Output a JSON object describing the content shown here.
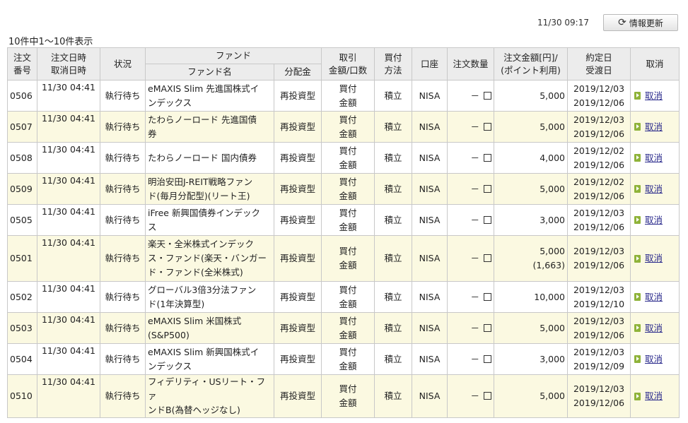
{
  "header": {
    "timestamp": "11/30 09:17",
    "refresh_label": "情報更新",
    "refresh_icon": "refresh-icon",
    "count_text": "10件中1～10件表示"
  },
  "table": {
    "headers": {
      "order_no": [
        "注文",
        "番号"
      ],
      "order_datetime": [
        "注文日時",
        "取消日時"
      ],
      "status": "状況",
      "fund_group": "ファンド",
      "fund_name": "ファンド名",
      "distribution": "分配金",
      "trade": [
        "取引",
        "金額/口数"
      ],
      "method": [
        "買付",
        "方法"
      ],
      "account": "口座",
      "quantity": "注文数量",
      "amount": [
        "注文金額[円]/",
        "(ポイント利用)"
      ],
      "dates": [
        "約定日",
        "受渡日"
      ],
      "cancel": "取消"
    },
    "rows": [
      {
        "no": "0506",
        "dt": "11/30 04:41",
        "status": "執行待ち",
        "fund": [
          "eMAXIS Slim 先進国株式イ",
          "ンデックス"
        ],
        "dist": "再投資型",
        "trade": [
          "買付",
          "金額"
        ],
        "method": "積立",
        "account": "NISA",
        "qty": "－",
        "amount": "5,000",
        "points": "",
        "date1": "2019/12/03",
        "date2": "2019/12/06",
        "cancel": "取消"
      },
      {
        "no": "0507",
        "dt": "11/30 04:41",
        "status": "執行待ち",
        "fund": [
          "たわらノーロード 先進国債",
          "券"
        ],
        "dist": "再投資型",
        "trade": [
          "買付",
          "金額"
        ],
        "method": "積立",
        "account": "NISA",
        "qty": "－",
        "amount": "5,000",
        "points": "",
        "date1": "2019/12/03",
        "date2": "2019/12/06",
        "cancel": "取消"
      },
      {
        "no": "0508",
        "dt": "11/30 04:41",
        "status": "執行待ち",
        "fund": [
          "たわらノーロード 国内債券",
          ""
        ],
        "dist": "再投資型",
        "trade": [
          "買付",
          "金額"
        ],
        "method": "積立",
        "account": "NISA",
        "qty": "－",
        "amount": "4,000",
        "points": "",
        "date1": "2019/12/02",
        "date2": "2019/12/06",
        "cancel": "取消"
      },
      {
        "no": "0509",
        "dt": "11/30 04:41",
        "status": "執行待ち",
        "fund": [
          "明治安田J-REIT戦略ファン",
          "ド(毎月分配型)(リート王)"
        ],
        "dist": "再投資型",
        "trade": [
          "買付",
          "金額"
        ],
        "method": "積立",
        "account": "NISA",
        "qty": "－",
        "amount": "5,000",
        "points": "",
        "date1": "2019/12/02",
        "date2": "2019/12/06",
        "cancel": "取消"
      },
      {
        "no": "0505",
        "dt": "11/30 04:41",
        "status": "執行待ち",
        "fund": [
          "iFree 新興国債券インデック",
          "ス"
        ],
        "dist": "再投資型",
        "trade": [
          "買付",
          "金額"
        ],
        "method": "積立",
        "account": "NISA",
        "qty": "－",
        "amount": "3,000",
        "points": "",
        "date1": "2019/12/03",
        "date2": "2019/12/06",
        "cancel": "取消"
      },
      {
        "no": "0501",
        "dt": "11/30 04:41",
        "status": "執行待ち",
        "fund": [
          "楽天・全米株式インデック",
          "ス・ファンド(楽天・バンガー",
          "ド・ファンド(全米株式)"
        ],
        "dist": "再投資型",
        "trade": [
          "買付",
          "金額"
        ],
        "method": "積立",
        "account": "NISA",
        "qty": "－",
        "amount": "5,000",
        "points": "(1,663)",
        "date1": "2019/12/03",
        "date2": "2019/12/06",
        "cancel": "取消"
      },
      {
        "no": "0502",
        "dt": "11/30 04:41",
        "status": "執行待ち",
        "fund": [
          "グローバル3倍3分法ファン",
          "ド(1年決算型)"
        ],
        "dist": "再投資型",
        "trade": [
          "買付",
          "金額"
        ],
        "method": "積立",
        "account": "NISA",
        "qty": "－",
        "amount": "10,000",
        "points": "",
        "date1": "2019/12/03",
        "date2": "2019/12/10",
        "cancel": "取消"
      },
      {
        "no": "0503",
        "dt": "11/30 04:41",
        "status": "執行待ち",
        "fund": [
          "eMAXIS Slim 米国株式",
          "(S&P500)"
        ],
        "dist": "再投資型",
        "trade": [
          "買付",
          "金額"
        ],
        "method": "積立",
        "account": "NISA",
        "qty": "－",
        "amount": "5,000",
        "points": "",
        "date1": "2019/12/03",
        "date2": "2019/12/06",
        "cancel": "取消"
      },
      {
        "no": "0504",
        "dt": "11/30 04:41",
        "status": "執行待ち",
        "fund": [
          "eMAXIS Slim 新興国株式イ",
          "ンデックス"
        ],
        "dist": "再投資型",
        "trade": [
          "買付",
          "金額"
        ],
        "method": "積立",
        "account": "NISA",
        "qty": "－",
        "amount": "3,000",
        "points": "",
        "date1": "2019/12/03",
        "date2": "2019/12/09",
        "cancel": "取消"
      },
      {
        "no": "0510",
        "dt": "11/30 04:41",
        "status": "執行待ち",
        "fund": [
          "フィデリティ・USリート・ファ",
          "ンドB(為替ヘッジなし)"
        ],
        "dist": "再投資型",
        "trade": [
          "買付",
          "金額"
        ],
        "method": "積立",
        "account": "NISA",
        "qty": "－",
        "amount": "5,000",
        "points": "",
        "date1": "2019/12/03",
        "date2": "2019/12/06",
        "cancel": "取消"
      }
    ]
  },
  "colors": {
    "row_alt": "#fbf9e1",
    "header_bg": "#ececec",
    "link": "#2a2a8c",
    "cancel_icon": "#8fb33a"
  }
}
